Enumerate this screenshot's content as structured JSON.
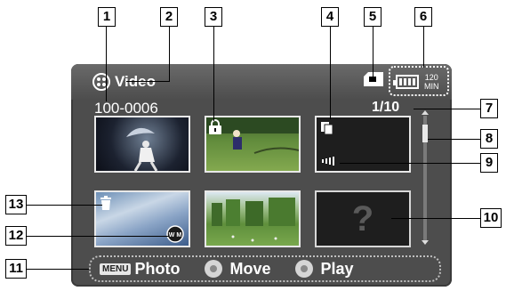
{
  "screen": {
    "mode_label": "Video",
    "folder_file": "100-0006",
    "counter": "1/10",
    "battery_minutes": "120",
    "battery_unit": "MIN"
  },
  "bottom_bar": {
    "menu_badge": "MENU",
    "photo_label": "Photo",
    "move_label": "Move",
    "play_label": "Play"
  },
  "thumbnails": [
    {
      "icon": "none"
    },
    {
      "icon": "lock-icon"
    },
    {
      "icon": "copy-icon",
      "indicator": "progress-icon"
    },
    {
      "icon": "trash-icon",
      "badge": "W M"
    },
    {
      "icon": "none"
    },
    {
      "icon": "question-mark",
      "text": "?"
    }
  ],
  "callouts": [
    "1",
    "2",
    "3",
    "4",
    "5",
    "6",
    "7",
    "8",
    "9",
    "10",
    "11",
    "12",
    "13"
  ]
}
